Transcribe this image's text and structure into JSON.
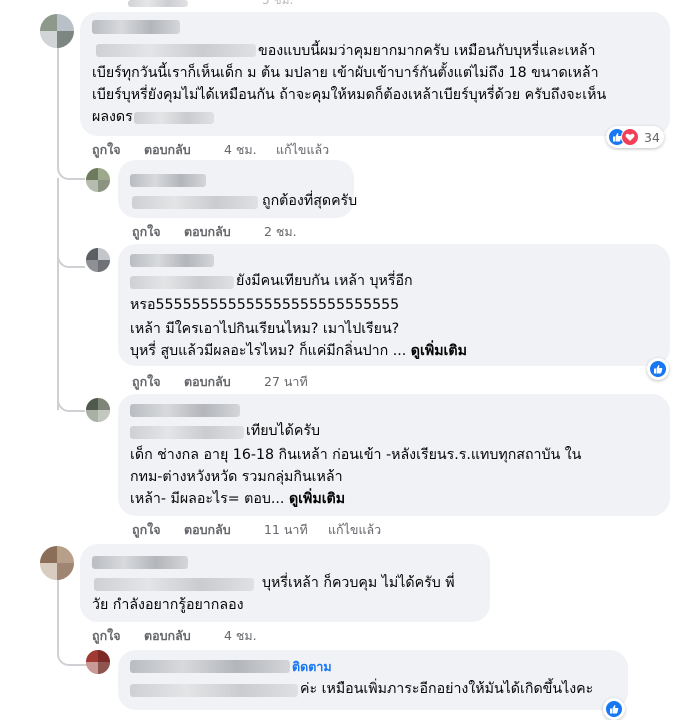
{
  "accent": "#1877f2",
  "love_color": "#f33e58",
  "top_fragment": "5 ชม.",
  "actions": {
    "like": "ถูกใจ",
    "reply": "ตอบกลับ",
    "edited": "แก้ไขแล้ว"
  },
  "comments": [
    {
      "lines": [
        "ของแบบนี้ผมว่าคุมยากมากครับ เหมือนกับบุหรี่และเหล้า",
        "เบียร์ทุกวันนี้เราก็เห็นเด็ก ม ต้น มปลาย เข้าผับเข้าบาร์กันตั้งแต่ไม่ถึง 18 ขนาดเหล้า",
        "เบียร์บุหรี่ยังคุมไม่ได้เหมือนกัน ถ้าจะคุมให้หมดก็ต้องเหล้าเบียร์บุหรี่ด้วย ครับถึงจะเห็น",
        "ผลงดร"
      ],
      "time": "4 ชม.",
      "edited": true,
      "reaction_count": "34",
      "reaction_icons": [
        "like-icon",
        "love-icon"
      ]
    },
    {
      "lines": [
        "ถูกต้องที่สุดครับ"
      ],
      "time": "2 ชม.",
      "edited": false
    },
    {
      "lines": [
        "ยังมีคนเทียบกัน เหล้า บุหรี่อีก",
        "หรอ555555555555555555555555555",
        "เหล้า มีใครเอาไปกินเรียนไหม? เมาไปเรียน?",
        "บุหรี่ สูบแล้วมีผลอะไรไหม? ก็แค่มีกลิ่นปาก ..."
      ],
      "see_more": "ดูเพิ่มเติม",
      "time": "27 นาที",
      "edited": false,
      "reaction_icons": [
        "like-icon"
      ]
    },
    {
      "lines": [
        "เทียบได้ครับ",
        "เด็ก ช่างกล อายุ 16-18 กินเหล้า ก่อนเข้า -หลังเรียนร.ร.แทบทุกสถาบัน ใน",
        "กทม-ต่างหวังหวัด รวมกลุ่มกินเหล้า",
        "เหล้า- มีผลอะไร= ตอบ..."
      ],
      "see_more": "ดูเพิ่มเติม",
      "time": "11 นาที",
      "edited": true
    },
    {
      "lines": [
        "บุหรี่เหล้า ก็ควบคุม ไม่ได้ครับ พี่",
        "วัย กำลังอยากรู้อยากลอง"
      ],
      "time": "4 ชม.",
      "edited": false
    },
    {
      "name_suffix": "ติดตาม",
      "lines": [
        "ค่ะ เหมือนเพิ่มภาระอีกอย่างให้มันได้เกิดขึ้นไงคะ"
      ],
      "reaction_icons": [
        "like-icon"
      ]
    }
  ]
}
